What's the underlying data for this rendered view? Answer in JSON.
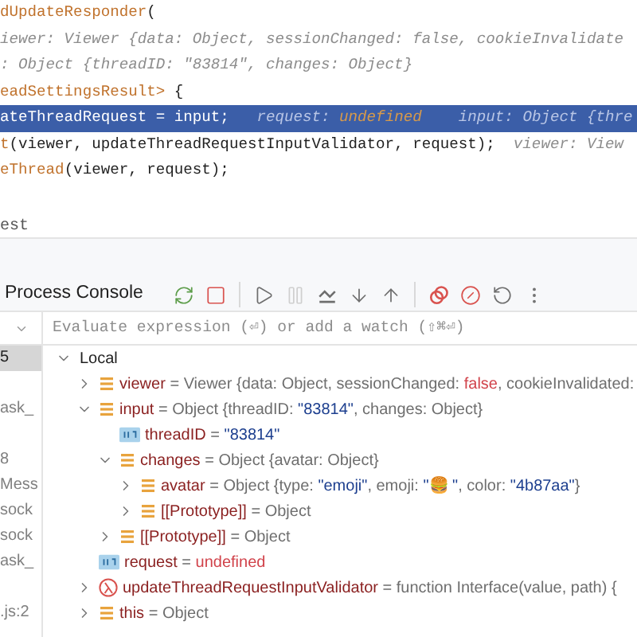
{
  "code_lines": [
    {
      "selected": false,
      "segments": [
        {
          "kind": "function",
          "text": "dUpdateResponder"
        },
        {
          "kind": "plain",
          "text": "("
        }
      ]
    },
    {
      "selected": false,
      "segments": [
        {
          "kind": "hint",
          "text": "iewer: Viewer {data: Object, sessionChanged: false, cookieInvalidate"
        }
      ]
    },
    {
      "selected": false,
      "segments": [
        {
          "kind": "hint",
          "text": ": Object {threadID: \"83814\", changes: Object}"
        }
      ]
    },
    {
      "selected": false,
      "segments": [
        {
          "kind": "function",
          "text": "eadSettingsResult>"
        },
        {
          "kind": "plain",
          "text": " {"
        }
      ]
    },
    {
      "selected": true,
      "segments": [
        {
          "kind": "plain",
          "text": "ateThreadRequest = input;"
        },
        {
          "kind": "hint",
          "text": "   request: "
        },
        {
          "kind": "hint_value",
          "text": "undefined"
        },
        {
          "kind": "hint",
          "text": "    input: Object {thre"
        }
      ]
    },
    {
      "selected": false,
      "segments": [
        {
          "kind": "function",
          "text": "t"
        },
        {
          "kind": "plain",
          "text": "(viewer, updateThreadRequestInputValidator, request);"
        },
        {
          "kind": "hint",
          "text": "  viewer: View"
        }
      ]
    },
    {
      "selected": false,
      "segments": [
        {
          "kind": "function",
          "text": "eThread"
        },
        {
          "kind": "plain",
          "text": "(viewer, request);"
        }
      ]
    }
  ],
  "editor_tab": "est",
  "debug_toolbar": {
    "tab": "Process Console",
    "buttons": [
      {
        "kind": "rerun",
        "disabled": false
      },
      {
        "kind": "stop",
        "disabled": false
      },
      {
        "kind": "separator"
      },
      {
        "kind": "resume",
        "disabled": false
      },
      {
        "kind": "pause",
        "disabled": true
      },
      {
        "kind": "step_over",
        "disabled": false
      },
      {
        "kind": "step_into",
        "disabled": false
      },
      {
        "kind": "step_out",
        "disabled": false
      },
      {
        "kind": "separator"
      },
      {
        "kind": "breakpoints",
        "disabled": false
      },
      {
        "kind": "mute",
        "disabled": false
      },
      {
        "kind": "reset_frame",
        "disabled": false
      },
      {
        "kind": "more",
        "disabled": false
      }
    ]
  },
  "evaluate": {
    "placeholder": "Evaluate expression (⏎) or add a watch (⇧⌘⏎)"
  },
  "frames": [
    {
      "text": "5",
      "selected": true
    },
    {
      "selected": false
    },
    {
      "text": "ask_",
      "selected": false
    },
    {
      "selected": false
    },
    {
      "text": "8",
      "selected": false
    },
    {
      "text": "Mess",
      "selected": false
    },
    {
      "text": "sock",
      "selected": false
    },
    {
      "text": "sock",
      "selected": false
    },
    {
      "text": "ask_",
      "selected": false
    },
    {
      "selected": false
    },
    {
      "text": ".js:2",
      "selected": false
    }
  ],
  "variables": [
    {
      "name": "Local",
      "kind": "scope",
      "expanded": true,
      "children": [
        {
          "name": "viewer",
          "operator": "=",
          "kind": "object",
          "expanded": false,
          "value": [
            {
              "kind": "plain",
              "text": "Viewer {data: Object, sessionChanged: "
            },
            {
              "kind": "keyword",
              "text": "false"
            },
            {
              "kind": "plain",
              "text": ", cookieInvalidated:"
            }
          ]
        },
        {
          "name": "input",
          "operator": "=",
          "kind": "object",
          "expanded": true,
          "value": [
            {
              "kind": "plain",
              "text": "Object {threadID: "
            },
            {
              "kind": "string",
              "text": "\"83814\""
            },
            {
              "kind": "plain",
              "text": ", changes: Object}"
            }
          ],
          "children": [
            {
              "name": "threadID",
              "operator": "=",
              "kind": "primitive",
              "value": [
                {
                  "kind": "string",
                  "text": "\"83814\""
                }
              ]
            },
            {
              "name": "changes",
              "operator": "=",
              "kind": "object",
              "expanded": true,
              "value": [
                {
                  "kind": "plain",
                  "text": "Object {avatar: Object}"
                }
              ],
              "children": [
                {
                  "name": "avatar",
                  "operator": "=",
                  "kind": "object",
                  "expanded": false,
                  "value": [
                    {
                      "kind": "plain",
                      "text": "Object {type: "
                    },
                    {
                      "kind": "string",
                      "text": "\"emoji\""
                    },
                    {
                      "kind": "plain",
                      "text": ", emoji: "
                    },
                    {
                      "kind": "string",
                      "text": "\"🍔 \""
                    },
                    {
                      "kind": "plain",
                      "text": ", color: "
                    },
                    {
                      "kind": "string",
                      "text": "\"4b87aa\""
                    },
                    {
                      "kind": "plain",
                      "text": "}"
                    }
                  ]
                },
                {
                  "name": "[[Prototype]]",
                  "operator": "=",
                  "kind": "object",
                  "expanded": false,
                  "value": [
                    {
                      "kind": "plain",
                      "text": "Object"
                    }
                  ]
                }
              ]
            },
            {
              "name": "[[Prototype]]",
              "operator": "=",
              "kind": "object",
              "expanded": false,
              "value": [
                {
                  "kind": "plain",
                  "text": "Object"
                }
              ]
            }
          ]
        },
        {
          "name": "request",
          "operator": "=",
          "kind": "primitive",
          "value": [
            {
              "kind": "keyword",
              "text": "undefined"
            }
          ]
        },
        {
          "name": "updateThreadRequestInputValidator",
          "operator": "=",
          "kind": "function",
          "expanded": false,
          "value": [
            {
              "kind": "plain",
              "text": "function Interface(value, path) {"
            }
          ]
        },
        {
          "name": "this",
          "operator": "=",
          "kind": "object",
          "expanded": false,
          "value": [
            {
              "kind": "plain",
              "text": "Object"
            }
          ]
        }
      ]
    }
  ]
}
